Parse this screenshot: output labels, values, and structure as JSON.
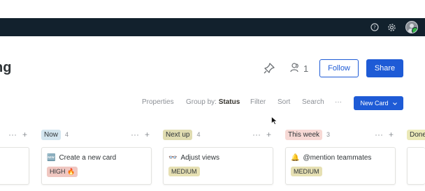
{
  "topbar": {
    "help_icon": "question-circle-icon",
    "settings_icon": "gear-icon",
    "avatar_status_color": "#2fb344"
  },
  "page": {
    "title_fragment": "ng",
    "members_count": "1",
    "follow_label": "Follow",
    "share_label": "Share"
  },
  "toolbar": {
    "properties": "Properties",
    "group_by_label": "Group by:",
    "group_by_value": "Status",
    "filter": "Filter",
    "sort": "Sort",
    "search": "Search",
    "more": "···",
    "new_card_label": "New Card"
  },
  "board": {
    "columns": [
      {
        "name": "Now",
        "count": "4",
        "color": "#d3e5ef"
      },
      {
        "name": "Next up",
        "count": "4",
        "color": "#e0dcb1"
      },
      {
        "name": "This week",
        "count": "3",
        "color": "#f7d9d5"
      },
      {
        "name": "Done",
        "count": "",
        "color": "#ebe9b8"
      }
    ],
    "cards": [
      {
        "icon": "🆕",
        "title": "Create a new card",
        "tag": "HIGH 🔥",
        "tag_color": "#f0c7c1"
      },
      {
        "icon": "👓",
        "title": "Adjust views",
        "tag": "MEDIUM",
        "tag_color": "#e6e0b3"
      },
      {
        "icon": "🔔",
        "title": "@mention teammates",
        "tag": "MEDIUM",
        "tag_color": "#e6e0b3"
      }
    ],
    "col_more": "···",
    "col_add": "+"
  },
  "colors": {
    "accent": "#1e5bd6",
    "header_bg": "#12212d"
  }
}
